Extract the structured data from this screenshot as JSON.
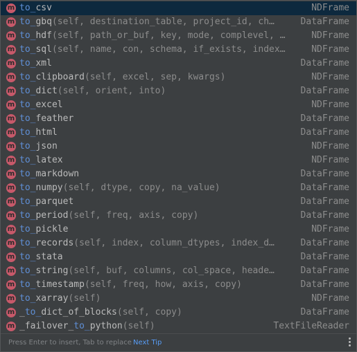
{
  "completion": {
    "icon_letter": "m",
    "items": [
      {
        "pre": "",
        "match": "to_",
        "rest": "csv",
        "params": "",
        "owner": "NDFrame"
      },
      {
        "pre": "",
        "match": "to_",
        "rest": "gbq",
        "params": "(self, destination_table, project_id, ch…",
        "owner": "DataFrame"
      },
      {
        "pre": "",
        "match": "to_",
        "rest": "hdf",
        "params": "(self, path_or_buf, key, mode, complevel, …",
        "owner": "NDFrame"
      },
      {
        "pre": "",
        "match": "to_",
        "rest": "sql",
        "params": "(self, name, con, schema, if_exists, index…",
        "owner": "NDFrame"
      },
      {
        "pre": "",
        "match": "to_",
        "rest": "xml",
        "params": "",
        "owner": "DataFrame"
      },
      {
        "pre": "",
        "match": "to_",
        "rest": "clipboard",
        "params": "(self, excel, sep, kwargs)",
        "owner": "NDFrame"
      },
      {
        "pre": "",
        "match": "to_",
        "rest": "dict",
        "params": "(self, orient, into)",
        "owner": "DataFrame"
      },
      {
        "pre": "",
        "match": "to_",
        "rest": "excel",
        "params": "",
        "owner": "NDFrame"
      },
      {
        "pre": "",
        "match": "to_",
        "rest": "feather",
        "params": "",
        "owner": "DataFrame"
      },
      {
        "pre": "",
        "match": "to_",
        "rest": "html",
        "params": "",
        "owner": "DataFrame"
      },
      {
        "pre": "",
        "match": "to_",
        "rest": "json",
        "params": "",
        "owner": "NDFrame"
      },
      {
        "pre": "",
        "match": "to_",
        "rest": "latex",
        "params": "",
        "owner": "NDFrame"
      },
      {
        "pre": "",
        "match": "to_",
        "rest": "markdown",
        "params": "",
        "owner": "DataFrame"
      },
      {
        "pre": "",
        "match": "to_",
        "rest": "numpy",
        "params": "(self, dtype, copy, na_value)",
        "owner": "DataFrame"
      },
      {
        "pre": "",
        "match": "to_",
        "rest": "parquet",
        "params": "",
        "owner": "DataFrame"
      },
      {
        "pre": "",
        "match": "to_",
        "rest": "period",
        "params": "(self, freq, axis, copy)",
        "owner": "DataFrame"
      },
      {
        "pre": "",
        "match": "to_",
        "rest": "pickle",
        "params": "",
        "owner": "NDFrame"
      },
      {
        "pre": "",
        "match": "to_",
        "rest": "records",
        "params": "(self, index, column_dtypes, index_d…",
        "owner": "DataFrame"
      },
      {
        "pre": "",
        "match": "to_",
        "rest": "stata",
        "params": "",
        "owner": "DataFrame"
      },
      {
        "pre": "",
        "match": "to_",
        "rest": "string",
        "params": "(self, buf, columns, col_space, heade…",
        "owner": "DataFrame"
      },
      {
        "pre": "",
        "match": "to_",
        "rest": "timestamp",
        "params": "(self, freq, how, axis, copy)",
        "owner": "DataFrame"
      },
      {
        "pre": "",
        "match": "to_",
        "rest": "xarray",
        "params": "(self)",
        "owner": "NDFrame"
      },
      {
        "pre": "_",
        "match": "to_",
        "rest": "dict_of_blocks",
        "params": "(self, copy)",
        "owner": "DataFrame"
      },
      {
        "pre": "_failover_",
        "match": "to_",
        "rest": "python",
        "params": "(self)",
        "owner": "TextFileReader"
      }
    ]
  },
  "footer": {
    "hint": "Press Enter to insert, Tab to replace",
    "next_tip": "Next Tip",
    "more_icon": "vertical-ellipsis-icon"
  },
  "colors": {
    "background": "#3c3f41",
    "selected_row": "#0d293e",
    "method_icon": "#c7596a",
    "match_text": "#5f8fd6",
    "link": "#589df6"
  }
}
